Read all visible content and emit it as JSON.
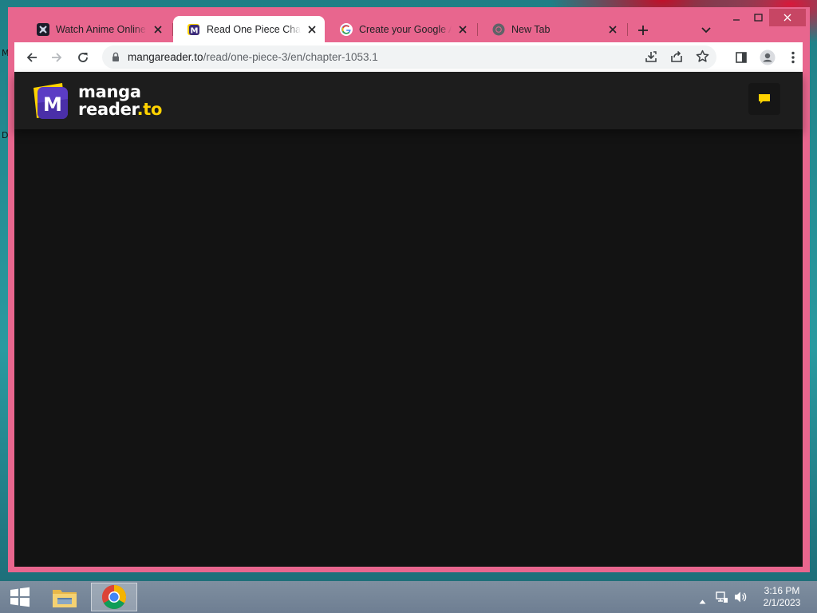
{
  "desktop": {
    "edge_letters": [
      "M",
      "D"
    ]
  },
  "browser": {
    "tabs": [
      {
        "title": "Watch Anime Online, Free",
        "favicon": "anime-site-icon",
        "active": false
      },
      {
        "title": "Read One Piece Chapter",
        "favicon": "mangareader-icon",
        "active": true
      },
      {
        "title": "Create your Google Account",
        "favicon": "google-icon",
        "active": false
      },
      {
        "title": "New Tab",
        "favicon": "chrome-icon",
        "active": false
      }
    ],
    "new_tab_label": "+",
    "url": {
      "host": "mangareader.to",
      "path": "/read/one-piece-3/en/chapter-1053.1"
    }
  },
  "site": {
    "logo_line1": "manga",
    "logo_line2_main": "reader",
    "logo_line2_tld": ".to",
    "logo_letter": "M",
    "accent": "#ffd200",
    "logo_purple": "#5b3cc4"
  },
  "taskbar": {
    "time": "3:16 PM",
    "date": "2/1/2023"
  },
  "colors": {
    "window_frame": "#e8668e",
    "page_bg": "#131313",
    "header_bg": "#1d1d1d"
  }
}
